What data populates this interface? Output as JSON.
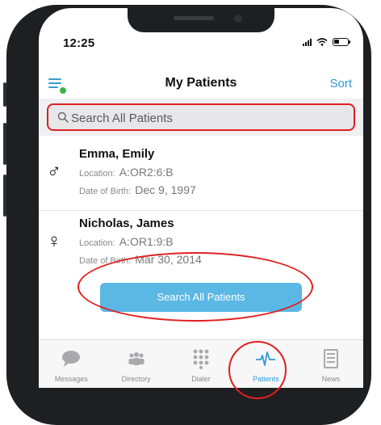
{
  "status_bar": {
    "time": "12:25",
    "battery_level": 0.4
  },
  "header": {
    "title": "My Patients",
    "sort_label": "Sort"
  },
  "search": {
    "placeholder": "Search All Patients",
    "value": ""
  },
  "patients": [
    {
      "name": "Emma, Emily",
      "gender_symbol": "♂",
      "location_label": "Location:",
      "location": "A:OR2:6:B",
      "dob_label": "Date of Birth:",
      "dob": "Dec 9, 1997"
    },
    {
      "name": "Nicholas, James",
      "gender_symbol": "♀",
      "location_label": "Location:",
      "location": "A:OR1:9:B",
      "dob_label": "Date of Birth:",
      "dob": "Mar 30, 2014"
    }
  ],
  "search_all_button": {
    "label": "Search All Patients"
  },
  "tabs": [
    {
      "label": "Messages",
      "icon": "chat-bubble-icon"
    },
    {
      "label": "Directory",
      "icon": "people-icon"
    },
    {
      "label": "Dialer",
      "icon": "keypad-icon"
    },
    {
      "label": "Patients",
      "icon": "heartbeat-icon",
      "active": true
    },
    {
      "label": "News",
      "icon": "newspaper-icon"
    }
  ],
  "colors": {
    "accent": "#2f9bd6",
    "button": "#5bb7e4",
    "highlight": "#e01e1e",
    "online": "#3cb44b"
  }
}
